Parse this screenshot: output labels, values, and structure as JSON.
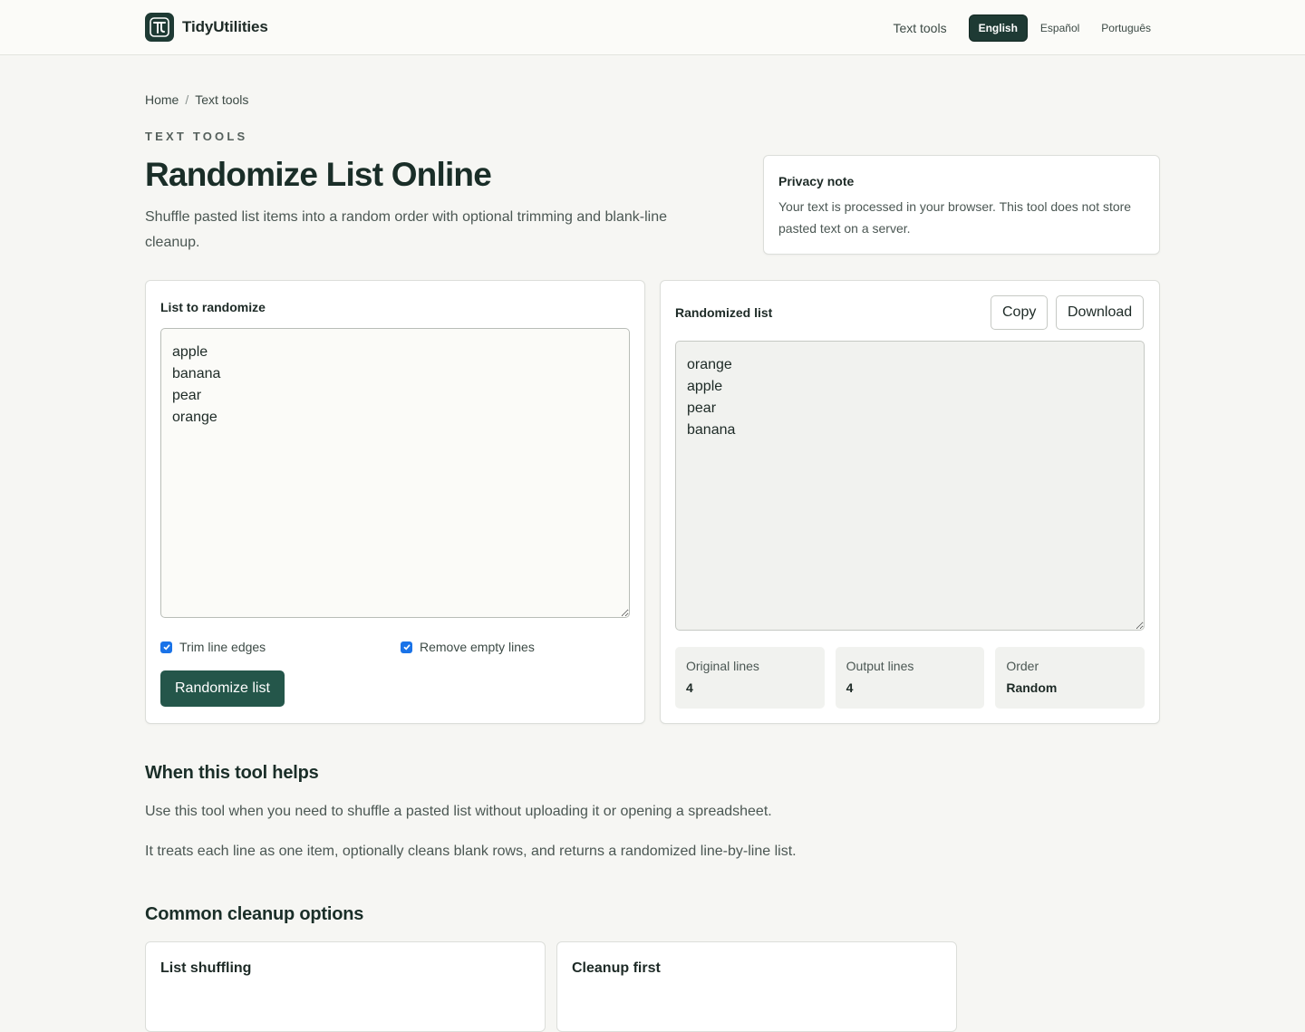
{
  "brand": {
    "name": "TidyUtilities",
    "logo_icon": "tidy-logo-icon",
    "logo_color": "#1e3a34"
  },
  "nav": {
    "text_tools": "Text tools",
    "languages": [
      {
        "label": "English",
        "active": true
      },
      {
        "label": "Español",
        "active": false
      },
      {
        "label": "Português",
        "active": false
      }
    ]
  },
  "breadcrumb": {
    "home": "Home",
    "separator": "/",
    "current": "Text tools"
  },
  "hero": {
    "eyebrow": "TEXT TOOLS",
    "title": "Randomize List Online",
    "subtitle": "Shuffle pasted list items into a random order with optional trimming and blank-line cleanup."
  },
  "privacy": {
    "title": "Privacy note",
    "body": "Your text is processed in your browser. This tool does not store pasted text on a server."
  },
  "input_panel": {
    "label": "List to randomize",
    "value": "apple\nbanana\npear\norange",
    "options": [
      {
        "label": "Trim line edges",
        "checked": true
      },
      {
        "label": "Remove empty lines",
        "checked": true
      }
    ],
    "randomize_button": "Randomize list"
  },
  "output_panel": {
    "label": "Randomized list",
    "copy_button": "Copy",
    "download_button": "Download",
    "value": "orange\napple\npear\nbanana",
    "stats": [
      {
        "label": "Original lines",
        "value": "4"
      },
      {
        "label": "Output lines",
        "value": "4"
      },
      {
        "label": "Order",
        "value": "Random"
      }
    ]
  },
  "when_helps": {
    "heading": "When this tool helps",
    "paragraphs": [
      "Use this tool when you need to shuffle a pasted list without uploading it or opening a spreadsheet.",
      "It treats each line as one item, optionally cleans blank rows, and returns a randomized line-by-line list."
    ]
  },
  "cleanup": {
    "heading": "Common cleanup options",
    "cards": [
      {
        "title": "List shuffling",
        "body": ""
      },
      {
        "title": "Cleanup first",
        "body": ""
      }
    ]
  },
  "colors": {
    "accent": "#24564a",
    "dark": "#1e3a34",
    "checkbox": "#1a73e8",
    "background": "#f6f6f3"
  }
}
